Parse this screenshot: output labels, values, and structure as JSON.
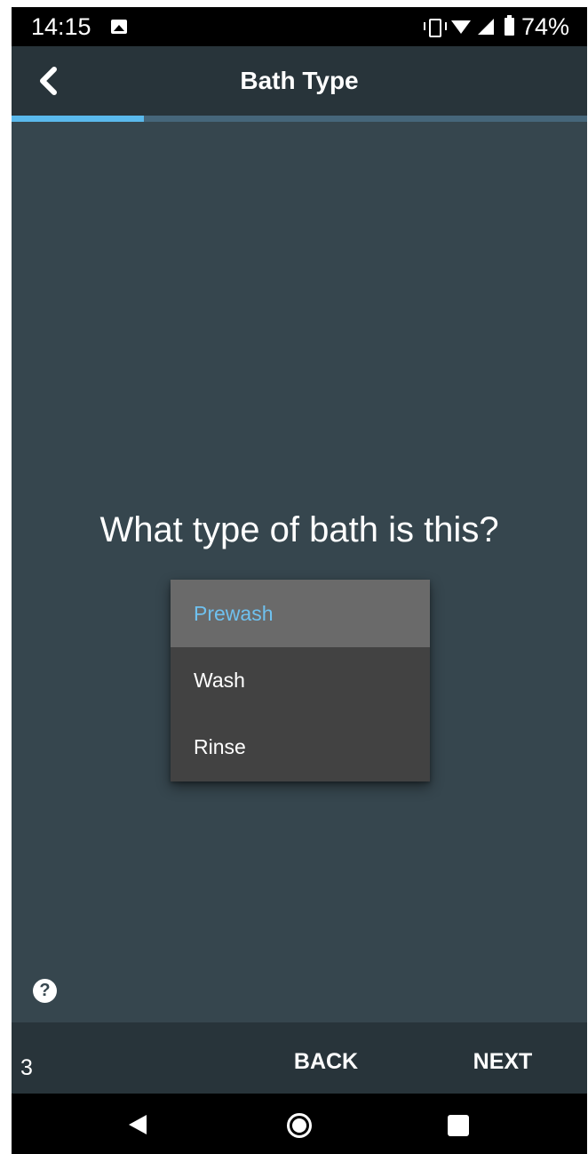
{
  "status_bar": {
    "time": "14:15",
    "battery": "74%",
    "icons": [
      "image-icon",
      "vibrate-icon",
      "wifi-icon",
      "signal-icon",
      "battery-icon"
    ]
  },
  "app_bar": {
    "title": "Bath Type",
    "back_icon": "chevron-left-icon"
  },
  "progress": {
    "fraction": 0.23,
    "color": "#5ab9ec"
  },
  "content": {
    "question": "What type of bath is this?",
    "options": [
      "Prewash",
      "Wash",
      "Rinse"
    ],
    "selected": "Prewash",
    "help_icon": "help-icon"
  },
  "bottom_bar": {
    "step": "3",
    "back_label": "BACK",
    "next_label": "NEXT"
  },
  "nav_bar": {
    "icons": [
      "nav-back-icon",
      "nav-home-icon",
      "nav-recents-icon"
    ]
  },
  "colors": {
    "background": "#36464e",
    "toolbar": "#28343a",
    "accent": "#6fc1ef",
    "menu": "#424242",
    "menu_selected": "#6a6a6a"
  }
}
